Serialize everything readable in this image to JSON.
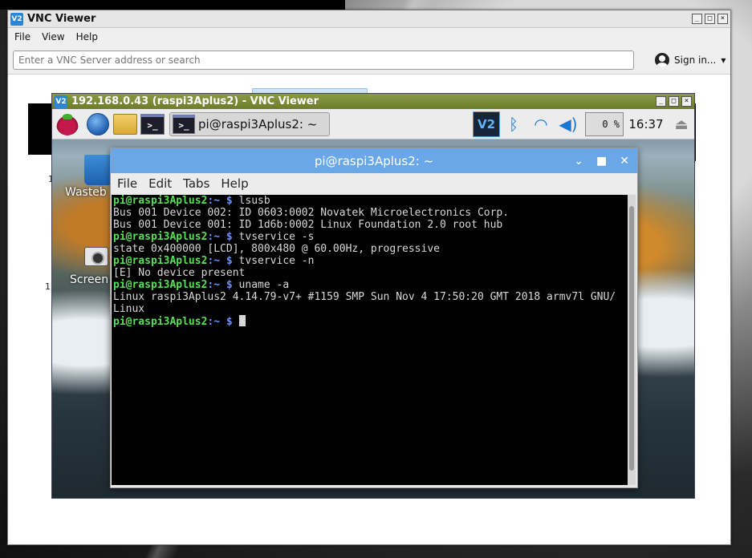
{
  "vnc_main": {
    "title": "VNC Viewer",
    "menu": {
      "file": "File",
      "view": "View",
      "help": "Help"
    },
    "address_placeholder": "Enter a VNC Server address or search",
    "sign_in": "Sign in...",
    "thumb_label_1": "1",
    "thumb_label_2": "1"
  },
  "session": {
    "title": "192.168.0.43 (raspi3Aplus2) - VNC Viewer",
    "taskbar_item": "pi@raspi3Aplus2: ~",
    "cpu": "0 %",
    "clock": "16:37",
    "desktop_icons": {
      "wastebasket": "Wasteb",
      "screenshot": "Screen"
    }
  },
  "terminal": {
    "title": "pi@raspi3Aplus2: ~",
    "menu": [
      "File",
      "Edit",
      "Tabs",
      "Help"
    ],
    "prompt_user": "pi@raspi3Aplus2",
    "prompt_path": ":~ $",
    "lines": [
      {
        "type": "cmd",
        "text": " lsusb"
      },
      {
        "type": "out",
        "text": "Bus 001 Device 002: ID 0603:0002 Novatek Microelectronics Corp."
      },
      {
        "type": "out",
        "text": "Bus 001 Device 001: ID 1d6b:0002 Linux Foundation 2.0 root hub"
      },
      {
        "type": "cmd",
        "text": " tvservice -s"
      },
      {
        "type": "out",
        "text": "state 0x400000 [LCD], 800x480 @ 60.00Hz, progressive"
      },
      {
        "type": "cmd",
        "text": " tvservice -n"
      },
      {
        "type": "out",
        "text": "[E] No device present"
      },
      {
        "type": "cmd",
        "text": " uname -a"
      },
      {
        "type": "out",
        "text": "Linux raspi3Aplus2 4.14.79-v7+ #1159 SMP Sun Nov 4 17:50:20 GMT 2018 armv7l GNU/"
      },
      {
        "type": "out",
        "text": "Linux"
      },
      {
        "type": "cmd",
        "text": " "
      }
    ]
  },
  "icons": [
    "vnc-logo-icon",
    "raspberry-icon",
    "globe-icon",
    "files-icon",
    "terminal-icon",
    "vnc-tray-icon",
    "bluetooth-icon",
    "wifi-icon",
    "volume-icon",
    "eject-icon",
    "user-icon"
  ]
}
